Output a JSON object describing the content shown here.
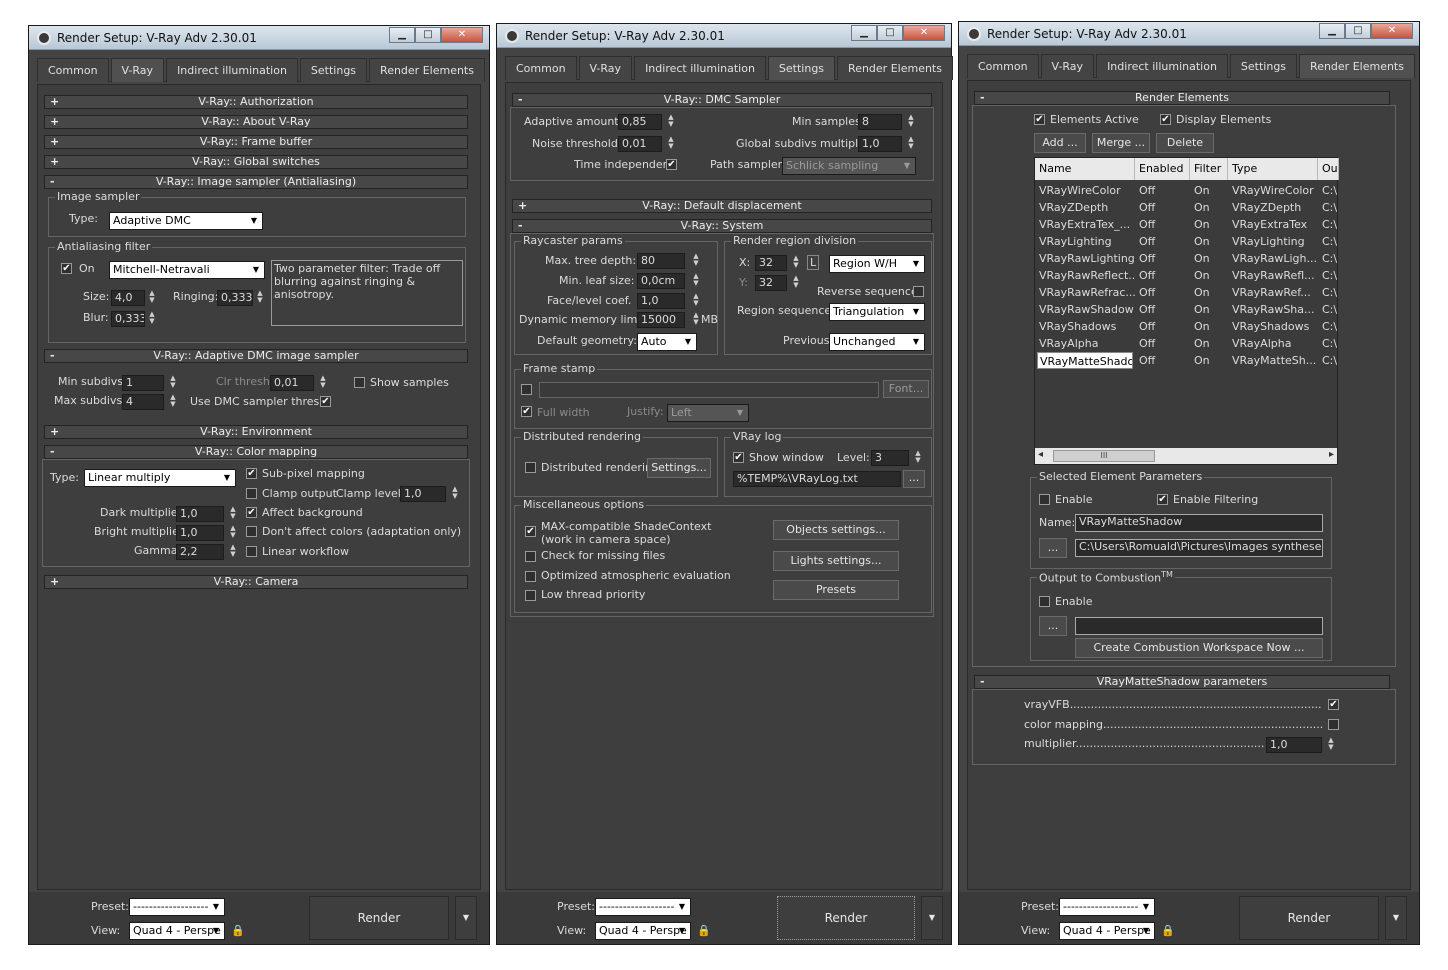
{
  "window_title": "Render Setup: V-Ray Adv 2.30.01",
  "tabs": [
    "Common",
    "V-Ray",
    "Indirect illumination",
    "Settings",
    "Render Elements"
  ],
  "window_buttons": {
    "min": "▁",
    "max": "□",
    "close": "✕"
  },
  "w1": {
    "rollouts": {
      "authorization": "V-Ray:: Authorization",
      "about": "V-Ray:: About V-Ray",
      "frame_buffer": "V-Ray:: Frame buffer",
      "global_switches": "V-Ray:: Global switches",
      "image_sampler": "V-Ray:: Image sampler (Antialiasing)",
      "adaptive_dmc": "V-Ray:: Adaptive DMC image sampler",
      "environment": "V-Ray:: Environment",
      "color_mapping": "V-Ray:: Color mapping",
      "camera": "V-Ray:: Camera"
    },
    "image_sampler": {
      "group": "Image sampler",
      "type_label": "Type:",
      "type_value": "Adaptive DMC"
    },
    "aa_filter": {
      "group": "Antialiasing filter",
      "on_label": "On",
      "filter_value": "Mitchell-Netravali",
      "description": "Two parameter filter: Trade off blurring against ringing & anisotropy.",
      "size_label": "Size:",
      "size_value": "4,0",
      "ringing_label": "Ringing:",
      "ringing_value": "0,333",
      "blur_label": "Blur:",
      "blur_value": "0,333"
    },
    "adaptive": {
      "min_subdivs_label": "Min subdivs:",
      "min_subdivs": "1",
      "max_subdivs_label": "Max subdivs:",
      "max_subdivs": "4",
      "clr_thresh_label": "Clr thresh:",
      "clr_thresh": "0,01",
      "show_samples": "Show samples",
      "use_dmc": "Use DMC sampler thresh."
    },
    "color_mapping": {
      "type_label": "Type:",
      "type_value": "Linear multiply",
      "sub_pixel": "Sub-pixel mapping",
      "clamp_output": "Clamp output",
      "clamp_level_label": "Clamp level:",
      "clamp_level": "1,0",
      "dark_label": "Dark multiplier:",
      "dark": "1,0",
      "bright_label": "Bright multiplier:",
      "bright": "1,0",
      "gamma_label": "Gamma:",
      "gamma": "2,2",
      "affect_bg": "Affect background",
      "dont_affect": "Don't affect colors (adaptation only)",
      "linear_workflow": "Linear workflow"
    }
  },
  "w2": {
    "dmc_title": "V-Ray:: DMC Sampler",
    "adaptive_amount_label": "Adaptive amount:",
    "adaptive_amount": "0,85",
    "noise_label": "Noise threshold:",
    "noise": "0,01",
    "time_indep": "Time independent",
    "min_samples_label": "Min samples:",
    "min_samples": "8",
    "global_subdivs_label": "Global subdivs multiplier:",
    "global_subdivs": "1,0",
    "path_sampler_label": "Path sampler:",
    "path_sampler": "Schlick sampling",
    "default_displacement": "V-Ray:: Default displacement",
    "system_title": "V-Ray:: System",
    "raycaster": {
      "group": "Raycaster params",
      "max_tree_label": "Max. tree depth:",
      "max_tree": "80",
      "min_leaf_label": "Min. leaf size:",
      "min_leaf": "0,0cm",
      "face_label": "Face/level coef.",
      "face": "1,0",
      "dyn_mem_label": "Dynamic memory limit:",
      "dyn_mem": "15000",
      "mb": "MB",
      "def_geom_label": "Default geometry:",
      "def_geom": "Auto"
    },
    "region": {
      "group": "Render region division",
      "x_label": "X:",
      "x": "32",
      "y_label": "Y:",
      "y": "32",
      "l": "L",
      "mode": "Region W/H",
      "reverse": "Reverse sequence",
      "seq_label": "Region sequence:",
      "seq": "Triangulation",
      "prev_label": "Previous",
      "prev": "Unchanged"
    },
    "frame_stamp": {
      "group": "Frame stamp",
      "font": "Font...",
      "full_width": "Full width",
      "justify_label": "Justify:",
      "justify": "Left"
    },
    "distributed": {
      "group": "Distributed rendering",
      "label": "Distributed rendering",
      "settings": "Settings..."
    },
    "vraylog": {
      "group": "VRay log",
      "show_window": "Show window",
      "level_label": "Level:",
      "level": "3",
      "path": "%TEMP%\\VRayLog.txt",
      "browse": "..."
    },
    "misc": {
      "group": "Miscellaneous options",
      "max_compat_1": "MAX-compatible ShadeContext",
      "max_compat_2": "(work in camera space)",
      "check_missing": "Check for missing files",
      "optimized": "Optimized atmospheric evaluation",
      "low_thread": "Low thread priority",
      "objects_settings": "Objects settings...",
      "lights_settings": "Lights settings...",
      "presets": "Presets"
    }
  },
  "w3": {
    "title": "Render Elements",
    "elements_active": "Elements Active",
    "display_elements": "Display Elements",
    "add": "Add ...",
    "merge": "Merge ...",
    "delete": "Delete",
    "columns": [
      "Name",
      "Enabled",
      "Filter",
      "Type",
      "Ou"
    ],
    "rows": [
      [
        "VRayWireColor",
        "Off",
        "On",
        "VRayWireColor",
        "C:\\"
      ],
      [
        "VRayZDepth",
        "Off",
        "On",
        "VRayZDepth",
        "C:\\"
      ],
      [
        "VRayExtraTex_...",
        "Off",
        "On",
        "VRayExtraTex",
        "C:\\"
      ],
      [
        "VRayLighting",
        "Off",
        "On",
        "VRayLighting",
        "C:\\"
      ],
      [
        "VRayRawLighting",
        "Off",
        "On",
        "VRayRawLigh...",
        "C:\\"
      ],
      [
        "VRayRawReflect...",
        "Off",
        "On",
        "VRayRawRefl...",
        "C:\\"
      ],
      [
        "VRayRawRefrac...",
        "Off",
        "On",
        "VRayRawRef...",
        "C:\\"
      ],
      [
        "VRayRawShadow",
        "Off",
        "On",
        "VRayRawSha...",
        "C:\\"
      ],
      [
        "VRayShadows",
        "Off",
        "On",
        "VRayShadows",
        "C:\\"
      ],
      [
        "VRayAlpha",
        "Off",
        "On",
        "VRayAlpha",
        "C:\\"
      ],
      [
        "VRayMatteShadow",
        "Off",
        "On",
        "VRayMatteSh...",
        "C:\\"
      ]
    ],
    "scroll": {
      "left": "◂",
      "thumb": "III",
      "right": "▸"
    },
    "selected": {
      "group": "Selected Element Parameters",
      "enable": "Enable",
      "enable_filtering": "Enable Filtering",
      "name_label": "Name:",
      "name": "VRayMatteShadow",
      "browse": "...",
      "path": "C:\\Users\\Romuald\\Pictures\\Images syntheses\\Far"
    },
    "combustion": {
      "group": "Output to Combustion",
      "tm": "TM",
      "enable": "Enable",
      "browse": "...",
      "create": "Create Combustion Workspace Now ..."
    },
    "matte_params": {
      "title": "VRayMatteShadow parameters",
      "vrayvfb": "vrayVFB",
      "color_mapping": "color mapping",
      "multiplier": "multiplier",
      "multiplier_value": "1,0"
    }
  },
  "footer": {
    "preset_label": "Preset:",
    "preset_value": "-------------------",
    "view_label": "View:",
    "view_value": "Quad 4 - Perspe",
    "render": "Render"
  }
}
